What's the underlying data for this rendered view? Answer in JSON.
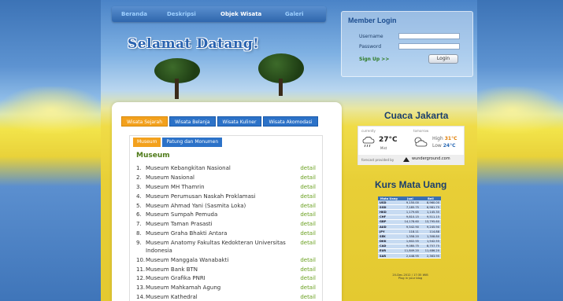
{
  "nav": {
    "items": [
      {
        "label": "Beranda",
        "active": false
      },
      {
        "label": "Deskripsi",
        "active": false
      },
      {
        "label": "Objek Wisata",
        "active": true
      },
      {
        "label": "Galeri",
        "active": false
      }
    ]
  },
  "hero": {
    "welcome": "Selamat Datang!"
  },
  "login": {
    "title": "Member Login",
    "username_label": "Username",
    "password_label": "Password",
    "signup_label": "Sign Up >>",
    "login_button": "Login"
  },
  "content": {
    "tabs": [
      {
        "label": "Wisata Sejarah",
        "active": true
      },
      {
        "label": "Wisata Belanja",
        "active": false
      },
      {
        "label": "Wisata Kuliner",
        "active": false
      },
      {
        "label": "Wisata Akomodasi",
        "active": false
      }
    ],
    "subtabs": [
      {
        "label": "Museum",
        "active": true
      },
      {
        "label": "Patung dan Monumen",
        "active": false
      }
    ],
    "category_title": "Museum",
    "detail_label": "detail",
    "items": [
      {
        "num": "1.",
        "name": "Museum Kebangkitan Nasional"
      },
      {
        "num": "2.",
        "name": "Museum Nasional"
      },
      {
        "num": "3.",
        "name": "Museum MH Thamrin"
      },
      {
        "num": "4.",
        "name": "Museum Perumusan Naskah Proklamasi"
      },
      {
        "num": "5.",
        "name": "Museum Ahmad Yani (Sasmita Loka)"
      },
      {
        "num": "6.",
        "name": "Museum Sumpah Pemuda"
      },
      {
        "num": "7.",
        "name": "Museum Taman Prasasti"
      },
      {
        "num": "8.",
        "name": "Museum Graha Bhakti Antara"
      },
      {
        "num": "9.",
        "name": "Museum Anatomy Fakultas Kedokteran Universitas Indonesia"
      },
      {
        "num": "10.",
        "name": "Museum Manggala Wanabakti"
      },
      {
        "num": "11.",
        "name": "Museum Bank BTN"
      },
      {
        "num": "12.",
        "name": "Museum Grafika PNRI"
      },
      {
        "num": "13.",
        "name": "Museum Mahkamah Agung"
      },
      {
        "num": "14.",
        "name": "Museum Kathedral"
      }
    ]
  },
  "weather": {
    "title": "Cuaca Jakarta",
    "currently_label": "currently",
    "tomorrow_label": "tomorrow",
    "current_temp": "27°C",
    "current_cond": "Mist",
    "high_label": "High",
    "high_value": "31°C",
    "low_label": "Low",
    "low_value": "24°C",
    "footer": "forecast provided by",
    "brand": "wunderground.com"
  },
  "kurs": {
    "title": "Kurs Mata Uang",
    "headers": [
      "Mata Uang",
      "Jual",
      "Beli"
    ],
    "rows": [
      [
        "USD",
        "9,150.00",
        "8,960.00"
      ],
      [
        "SGD",
        "7,185.75",
        "6,981.75"
      ],
      [
        "HKD",
        "1,179.65",
        "1,145.35"
      ],
      [
        "CHF",
        "9,810.15",
        "9,511.15"
      ],
      [
        "GBP",
        "14,178.60",
        "13,795.60"
      ],
      [
        "AUD",
        "9,542.90",
        "9,245.90"
      ],
      [
        "JPY",
        "118.11",
        "114.88"
      ],
      [
        "SEK",
        "1,358.20",
        "1,308.80"
      ],
      [
        "DKK",
        "1,602.55",
        "1,542.55"
      ],
      [
        "CAD",
        "9,080.75",
        "8,757.75"
      ],
      [
        "EUR",
        "11,849.20",
        "11,486.20"
      ],
      [
        "SAR",
        "2,448.95",
        "2,363.95"
      ]
    ],
    "footer_line1": "20-Dec-2012 / 17:35 WIB",
    "footer_line2": "Plug in your blog"
  }
}
